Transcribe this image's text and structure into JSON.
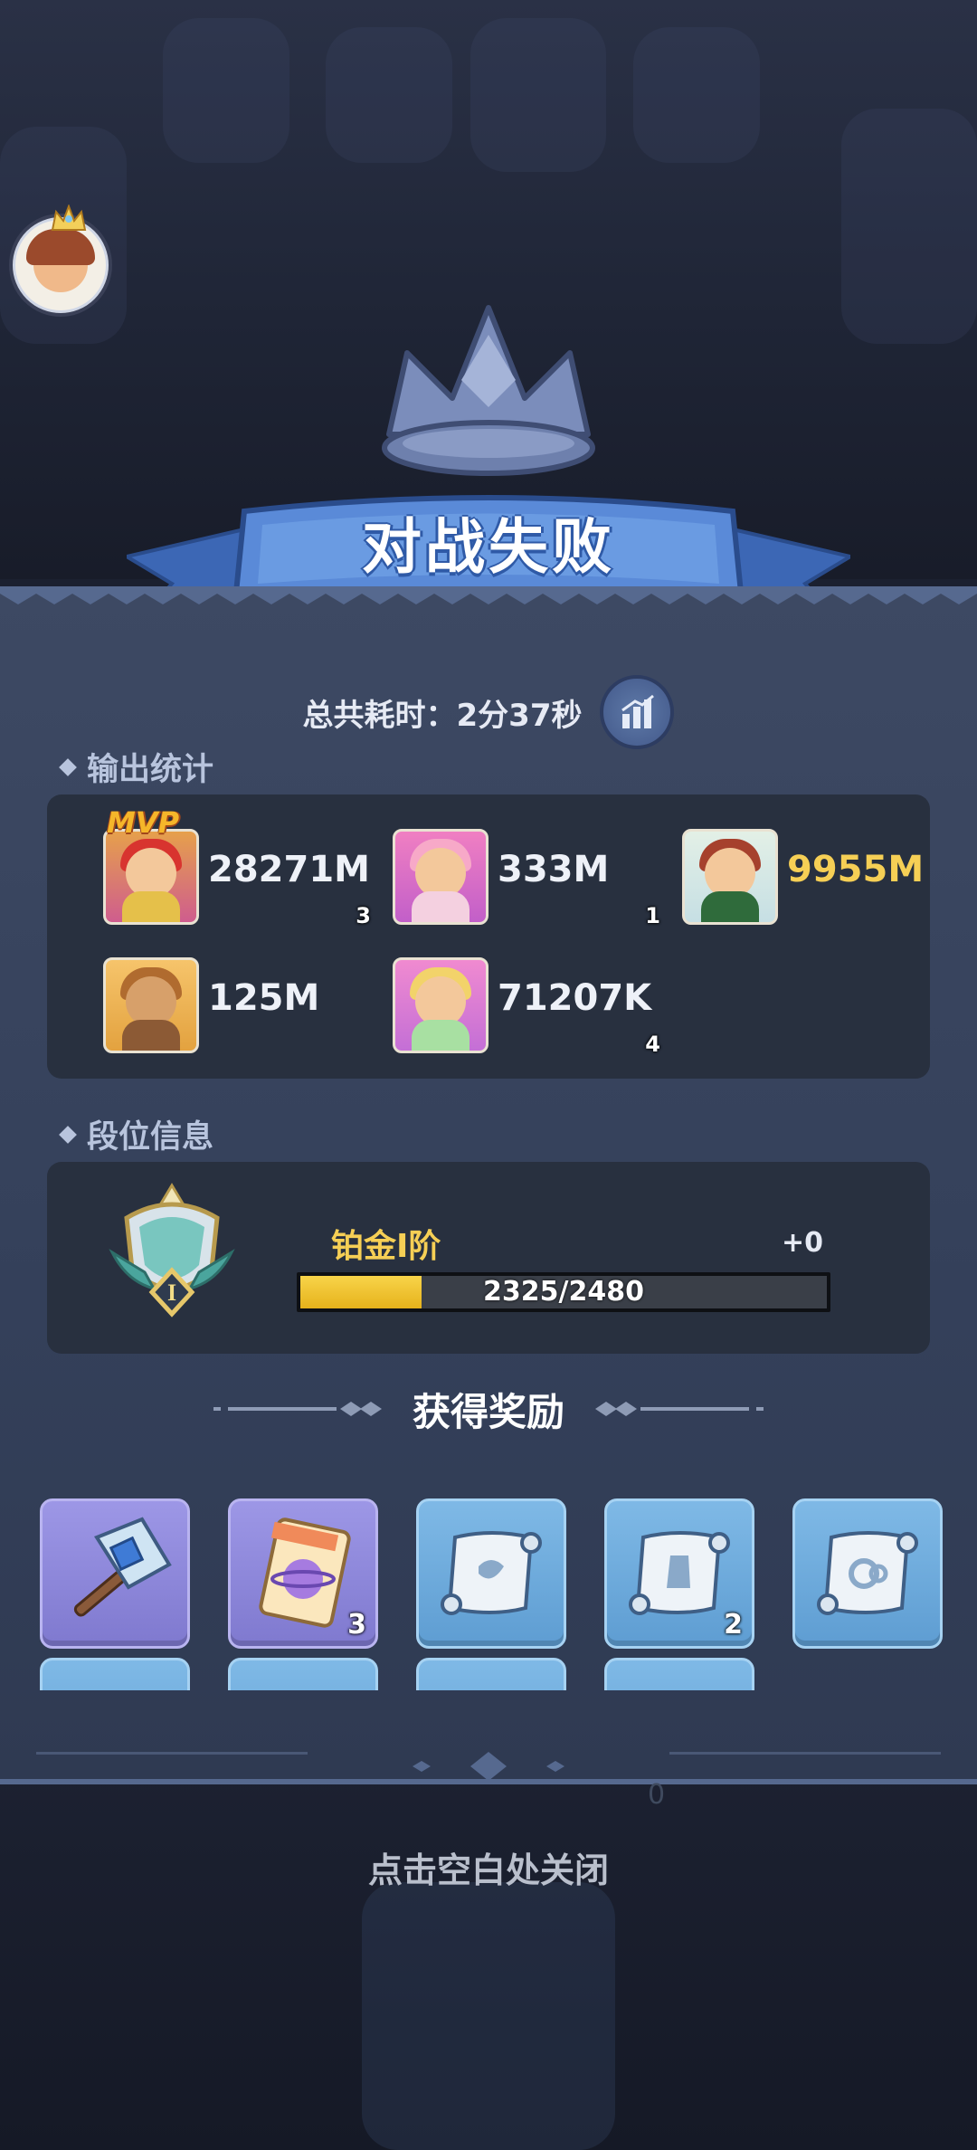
{
  "result": {
    "title": "对战失败"
  },
  "battle": {
    "total_time": "总共耗时：2分37秒"
  },
  "output_stats": {
    "label": "输出统计",
    "mvp_label": "MVP",
    "heroes": [
      {
        "damage": "28271M",
        "level": "3",
        "mvp": true,
        "highlight": false
      },
      {
        "damage": "333M",
        "level": "1",
        "mvp": false,
        "highlight": false
      },
      {
        "damage": "9955M",
        "level": "",
        "mvp": false,
        "highlight": true
      },
      {
        "damage": "125M",
        "level": "",
        "mvp": false,
        "highlight": false
      },
      {
        "damage": "71207K",
        "level": "4",
        "mvp": false,
        "highlight": false
      }
    ]
  },
  "rank_info": {
    "label": "段位信息",
    "name": "铂金I阶",
    "delta": "+0",
    "progress_text": "2325/2480",
    "progress_fraction": 0.23,
    "emblem_numeral": "I"
  },
  "rewards": {
    "title": "获得奖励",
    "items": [
      {
        "icon": "hammer-icon",
        "count": "",
        "rarity": "purple"
      },
      {
        "icon": "integral-card-icon",
        "count": "3",
        "rarity": "purple"
      },
      {
        "icon": "scroll-icon",
        "count": "",
        "rarity": "blue"
      },
      {
        "icon": "scroll-icon",
        "count": "2",
        "rarity": "blue"
      },
      {
        "icon": "scroll-icon",
        "count": "",
        "rarity": "blue"
      }
    ]
  },
  "hint": {
    "close": "点击空白处关闭"
  },
  "background": {
    "heart_count": "0"
  },
  "colors": {
    "accent_gold": "#f6cf55",
    "banner_blue": "#4f7fd0",
    "panel": "#3d4963"
  }
}
